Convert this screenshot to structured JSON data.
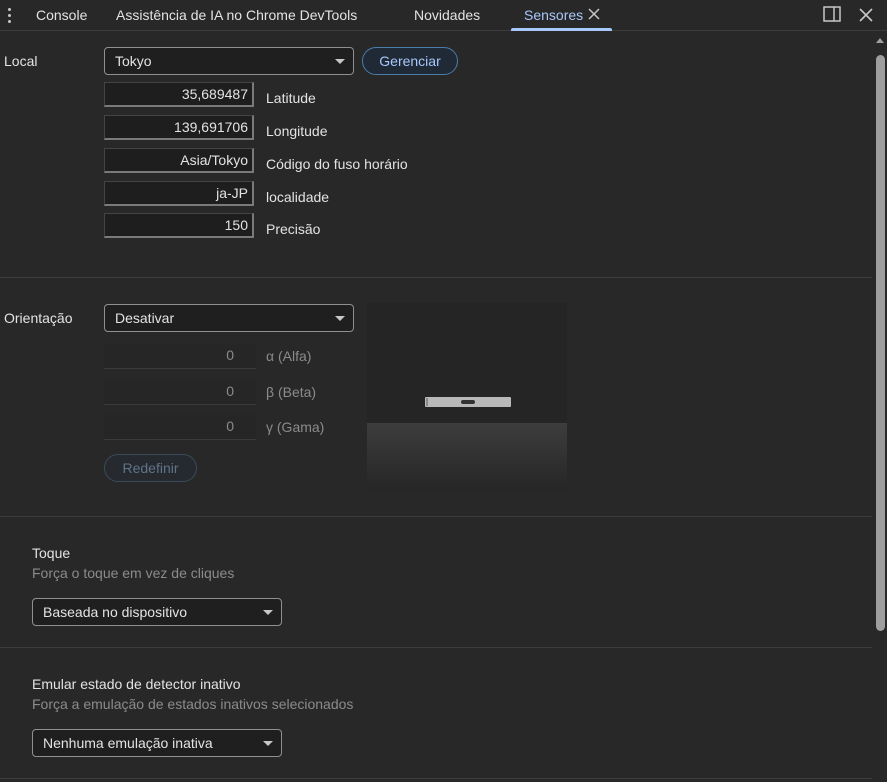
{
  "tabs": [
    {
      "label": "Console",
      "active": false
    },
    {
      "label": "Assistência de IA no Chrome DevTools",
      "active": false
    },
    {
      "label": "Novidades",
      "active": false
    },
    {
      "label": "Sensores",
      "active": true
    }
  ],
  "location": {
    "label": "Local",
    "selected": "Tokyo",
    "manage_button": "Gerenciar",
    "fields": [
      {
        "value": "35,689487",
        "label": "Latitude"
      },
      {
        "value": "139,691706",
        "label": "Longitude"
      },
      {
        "value": "Asia/Tokyo",
        "label": "Código do fuso horário"
      },
      {
        "value": "ja-JP",
        "label": "localidade"
      },
      {
        "value": "150",
        "label": "Precisão"
      }
    ]
  },
  "orientation": {
    "label": "Orientação",
    "selected": "Desativar",
    "fields": [
      {
        "value": "0",
        "label": "α (Alfa)"
      },
      {
        "value": "0",
        "label": "β (Beta)"
      },
      {
        "value": "0",
        "label": "γ (Gama)"
      }
    ],
    "reset_button": "Redefinir"
  },
  "touch": {
    "title": "Toque",
    "subtitle": "Força o toque em vez de cliques",
    "selected": "Baseada no dispositivo"
  },
  "idle": {
    "title": "Emular estado de detector inativo",
    "subtitle": "Força a emulação de estados inativos selecionados",
    "selected": "Nenhuma emulação inativa"
  },
  "icons": {
    "menu": "kebab-menu-icon",
    "tab_close": "close-icon",
    "dock": "dock-side-icon",
    "panel_close": "close-icon"
  }
}
